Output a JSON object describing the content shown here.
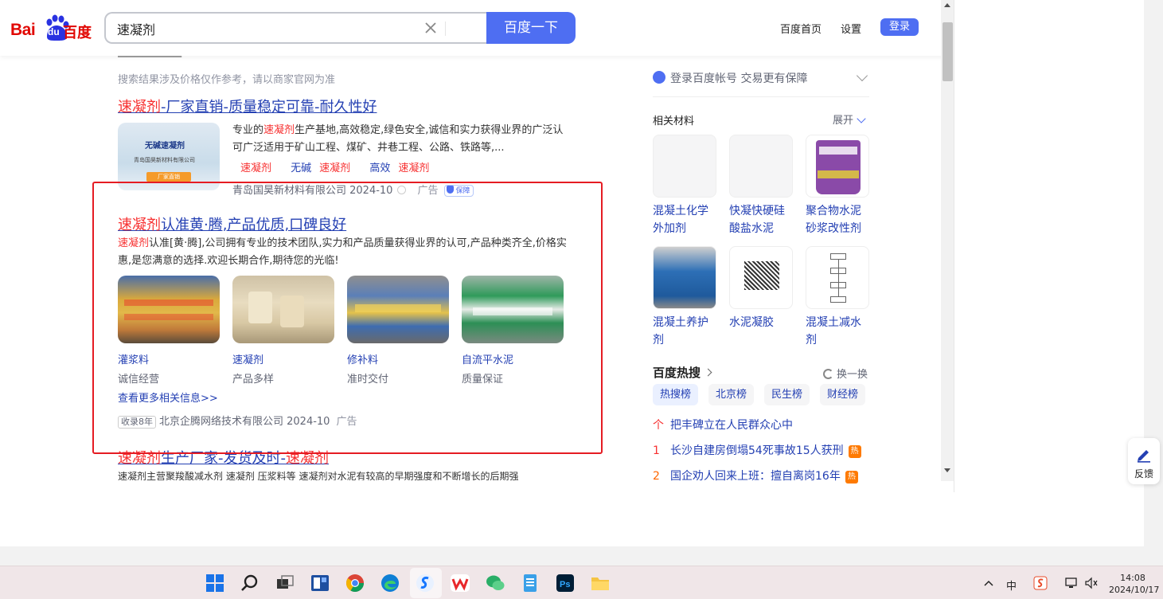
{
  "header": {
    "logo_bai": "Bai",
    "logo_du": "du",
    "logo_cn": "百度",
    "search_value": "速凝剂",
    "search_button": "百度一下",
    "links": [
      "百度首页",
      "设置"
    ],
    "login_button": "登录"
  },
  "results": {
    "notice": "搜索结果涉及价格仅作参考，请以商家官网为准",
    "r1": {
      "title_hl": "速凝剂",
      "title_rest": "-厂家直销-质量稳定可靠-耐久性好",
      "thumb_line1": "无碱速凝剂",
      "thumb_line2": "青岛国昊新材料有限公司",
      "thumb_line3": "厂家直销",
      "desc_pre": "专业的",
      "desc_hl": "速凝剂",
      "desc_post": "生产基地,高效稳定,绿色安全,诚信和实力获得业界的广泛认可广泛适用于矿山工程、煤矿、井巷工程、公路、铁路等,...",
      "tags": [
        {
          "pre": "",
          "hl": "速凝剂"
        },
        {
          "pre": "无碱",
          "hl": "速凝剂"
        },
        {
          "pre": "高效",
          "hl": "速凝剂"
        }
      ],
      "source": "青岛国昊新材料有限公司 2024-10",
      "ad": "广告",
      "badge": "保障"
    },
    "r2": {
      "title_hl": "速凝剂",
      "title_rest": "认准黄·腾,产品优质,口碑良好",
      "desc_hl": "速凝剂",
      "desc_post": "认准[黄·腾],公司拥有专业的技术团队,实力和产品质量获得业界的认可,产品种类齐全,价格实惠,是您满意的选择.欢迎长期合作,期待您的光临!",
      "products": [
        {
          "name": "灌浆料",
          "sub": "诚信经营",
          "hl": false
        },
        {
          "name": "速凝剂",
          "sub": "产品多样",
          "hl": true
        },
        {
          "name": "修补料",
          "sub": "准时交付",
          "hl": false
        },
        {
          "name": "自流平水泥",
          "sub": "质量保证",
          "hl": false
        }
      ],
      "more": "查看更多相关信息>>",
      "years": "收录8年",
      "source": "北京企腾网络技术有限公司 2024-10",
      "ad": "广告"
    },
    "r3": {
      "title_hl1": "速凝剂",
      "title_mid": "生产厂家-发货及时-",
      "title_hl2": "速凝剂",
      "desc": "速凝剂主营聚羧酸减水剂 速凝剂 压浆料等 速凝剂对水泥有较高的早期强度和不断增长的后期强"
    }
  },
  "sidebar": {
    "account": "登录百度帐号 交易更有保障",
    "related_title": "相关材料",
    "expand": "展开",
    "materials": [
      {
        "l1": "混凝土化学",
        "l2": "外加剂"
      },
      {
        "l1": "快凝快硬硅",
        "l2": "酸盐水泥"
      },
      {
        "l1": "聚合物水泥",
        "l2": "砂浆改性剂"
      },
      {
        "l1": "混凝土养护",
        "l2": "剂"
      },
      {
        "l1": "水泥凝胶",
        "l2": ""
      },
      {
        "l1": "混凝土减水",
        "l2": "剂"
      }
    ],
    "hot_title": "百度热搜",
    "refresh": "换一换",
    "hot_tabs": [
      "热搜榜",
      "北京榜",
      "民生榜",
      "财经榜"
    ],
    "hot_items": [
      {
        "rank": "个",
        "text": "把丰碑立在人民群众心中",
        "badge": ""
      },
      {
        "rank": "1",
        "text": "长沙自建房倒塌54死事故15人获刑",
        "badge": "热"
      },
      {
        "rank": "2",
        "text": "国企劝人回来上班：擅自离岗16年",
        "badge": "热"
      }
    ]
  },
  "feedback": "反馈",
  "clock": {
    "time": "14:08",
    "date": "2024/10/17"
  },
  "tray": {
    "ime": "中"
  }
}
